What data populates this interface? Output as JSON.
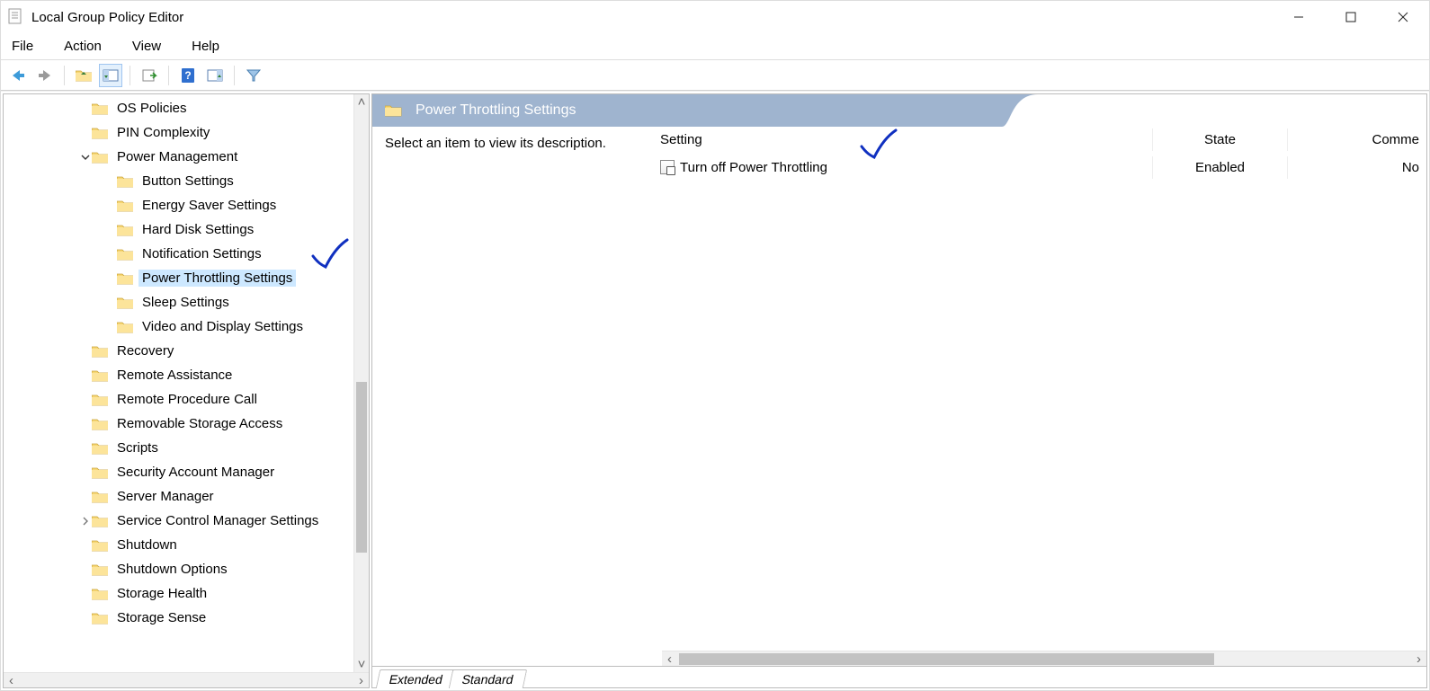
{
  "window": {
    "title": "Local Group Policy Editor"
  },
  "menu": {
    "file": "File",
    "action": "Action",
    "view": "View",
    "help": "Help"
  },
  "tree": {
    "items": [
      {
        "indent": 3,
        "chev": "",
        "label": "OS Policies"
      },
      {
        "indent": 3,
        "chev": "",
        "label": "PIN Complexity"
      },
      {
        "indent": 3,
        "chev": "v",
        "label": "Power Management"
      },
      {
        "indent": 4,
        "chev": "",
        "label": "Button Settings"
      },
      {
        "indent": 4,
        "chev": "",
        "label": "Energy Saver Settings"
      },
      {
        "indent": 4,
        "chev": "",
        "label": "Hard Disk Settings"
      },
      {
        "indent": 4,
        "chev": "",
        "label": "Notification Settings"
      },
      {
        "indent": 4,
        "chev": "",
        "label": "Power Throttling Settings",
        "selected": true
      },
      {
        "indent": 4,
        "chev": "",
        "label": "Sleep Settings"
      },
      {
        "indent": 4,
        "chev": "",
        "label": "Video and Display Settings"
      },
      {
        "indent": 3,
        "chev": "",
        "label": "Recovery"
      },
      {
        "indent": 3,
        "chev": "",
        "label": "Remote Assistance"
      },
      {
        "indent": 3,
        "chev": "",
        "label": "Remote Procedure Call"
      },
      {
        "indent": 3,
        "chev": "",
        "label": "Removable Storage Access"
      },
      {
        "indent": 3,
        "chev": "",
        "label": "Scripts"
      },
      {
        "indent": 3,
        "chev": "",
        "label": "Security Account Manager"
      },
      {
        "indent": 3,
        "chev": "",
        "label": "Server Manager"
      },
      {
        "indent": 3,
        "chev": ">",
        "label": "Service Control Manager Settings"
      },
      {
        "indent": 3,
        "chev": "",
        "label": "Shutdown"
      },
      {
        "indent": 3,
        "chev": "",
        "label": "Shutdown Options"
      },
      {
        "indent": 3,
        "chev": "",
        "label": "Storage Health"
      },
      {
        "indent": 3,
        "chev": "",
        "label": "Storage Sense"
      }
    ]
  },
  "details": {
    "header_title": "Power Throttling Settings",
    "description_placeholder": "Select an item to view its description.",
    "columns": {
      "setting": "Setting",
      "state": "State",
      "comment": "Comme"
    },
    "rows": [
      {
        "setting": "Turn off Power Throttling",
        "state": "Enabled",
        "comment": "No"
      }
    ],
    "tabs": {
      "extended": "Extended",
      "standard": "Standard"
    }
  }
}
